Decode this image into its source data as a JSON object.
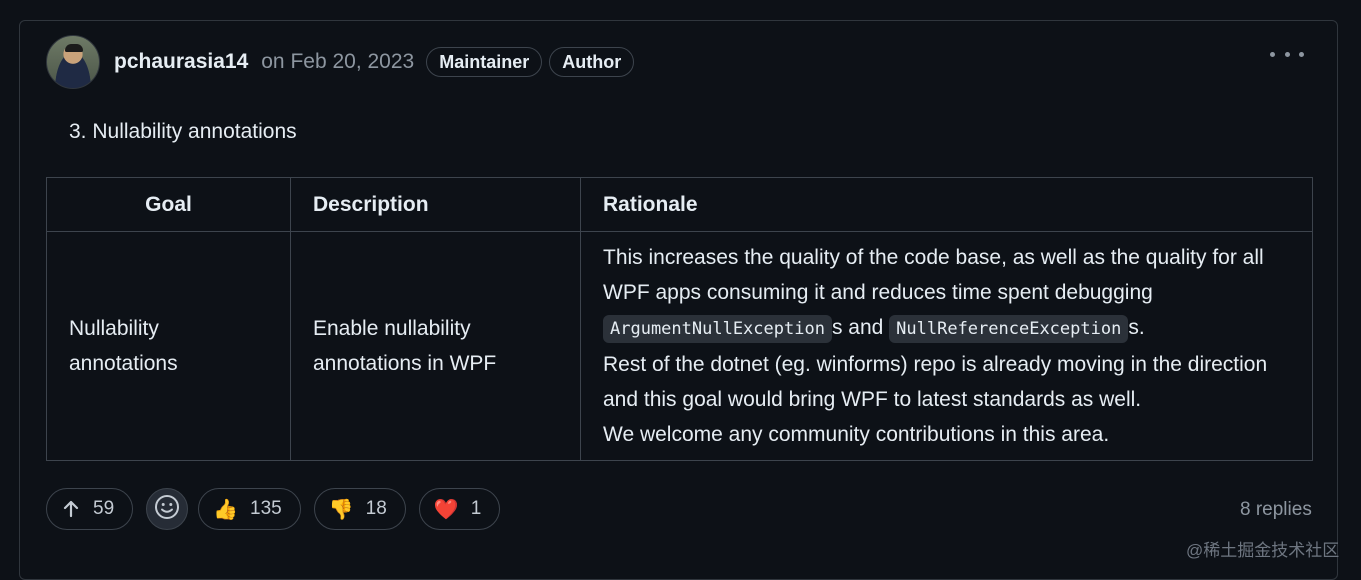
{
  "comment": {
    "author": "pchaurasia14",
    "date": "on Feb 20, 2023",
    "badges": [
      "Maintainer",
      "Author"
    ],
    "heading": "3. Nullability annotations",
    "table": {
      "headers": [
        "Goal",
        "Description",
        "Rationale"
      ],
      "row": {
        "goal": "Nullability annotations",
        "description": "Enable nullability annotations in WPF",
        "rationale": {
          "line1": "This increases the quality of the code base, as well as the quality for all WPF apps consuming it and reduces time spent debugging",
          "code1": "ArgumentNullException",
          "mid": "s and",
          "code2": "NullReferenceException",
          "end": "s.",
          "line2": "Rest of the dotnet (eg. winforms) repo is already moving in the direction and this goal would bring WPF to latest standards as well.",
          "line3": "We welcome any community contributions in this area."
        }
      }
    }
  },
  "footer": {
    "upvotes": "59",
    "reactions": [
      {
        "icon": "thumbs-up-icon",
        "glyph": "👍",
        "count": "135"
      },
      {
        "icon": "thumbs-down-icon",
        "glyph": "👎",
        "count": "18"
      },
      {
        "icon": "heart-icon",
        "glyph": "❤️",
        "count": "1"
      }
    ],
    "replies": "8 replies"
  },
  "watermark": "@稀土掘金技术社区",
  "colors": {
    "background": "#0d1117",
    "border": "#30363d",
    "muted": "#8d96a0",
    "text": "#e6edf3"
  }
}
